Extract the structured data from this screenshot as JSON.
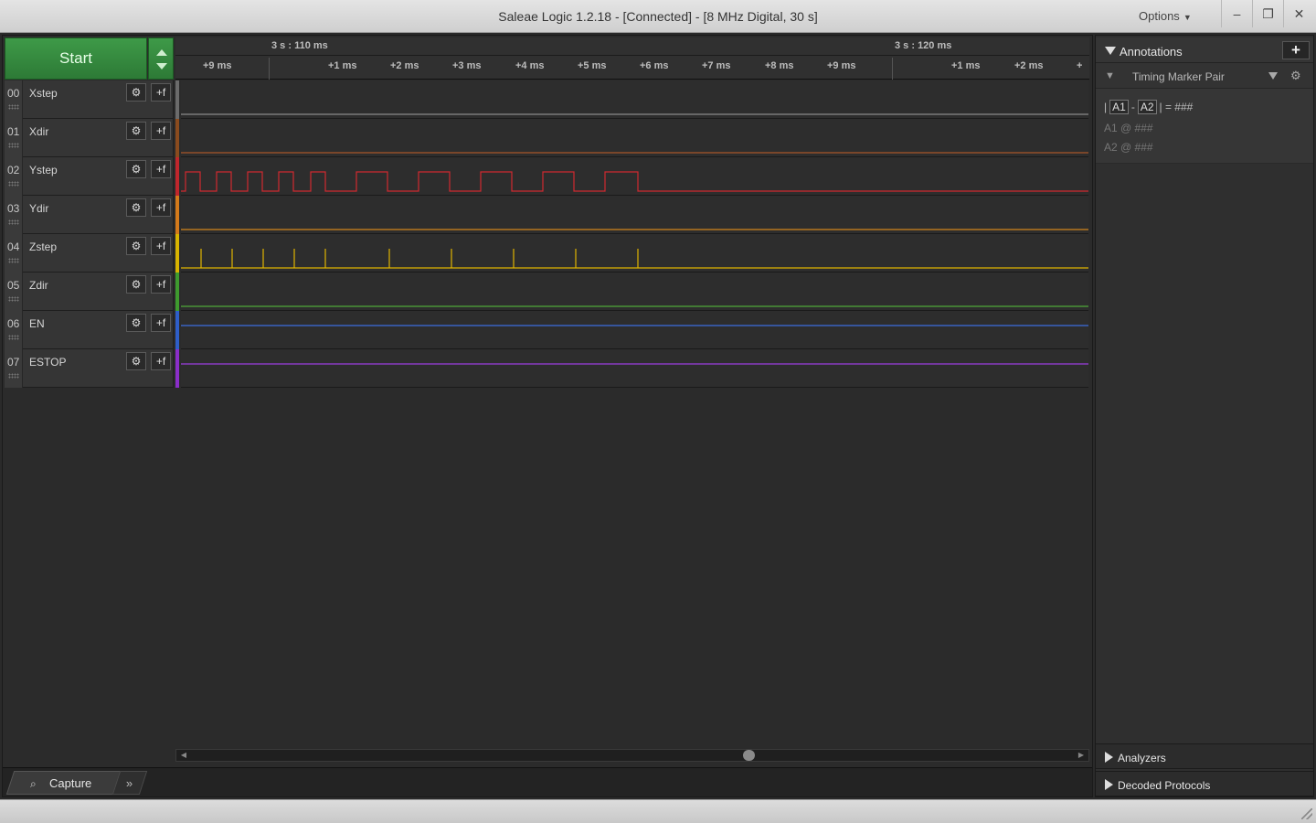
{
  "window": {
    "title": "Saleae Logic 1.2.18 - [Connected] - [8 MHz Digital, 30 s]",
    "options_label": "Options",
    "minimize": "–",
    "restore": "❐",
    "close": "✕"
  },
  "capture": {
    "start_label": "Start"
  },
  "timeline": {
    "major": [
      "3 s : 110 ms",
      "3 s : 120 ms"
    ],
    "minor": [
      "+9 ms",
      "+1 ms",
      "+2 ms",
      "+3 ms",
      "+4 ms",
      "+5 ms",
      "+6 ms",
      "+7 ms",
      "+8 ms",
      "+9 ms",
      "+1 ms",
      "+2 ms",
      "+"
    ]
  },
  "channels": [
    {
      "num": "00",
      "name": "Xstep",
      "color": "#6b6b6b",
      "trace": "#8a8a8a"
    },
    {
      "num": "01",
      "name": "Xdir",
      "color": "#8a4b1e",
      "trace": "#a8562a"
    },
    {
      "num": "02",
      "name": "Ystep",
      "color": "#c0262c",
      "trace": "#d02a30"
    },
    {
      "num": "03",
      "name": "Ydir",
      "color": "#d47a1a",
      "trace": "#d2861c"
    },
    {
      "num": "04",
      "name": "Zstep",
      "color": "#d8b400",
      "trace": "#e0b400"
    },
    {
      "num": "05",
      "name": "Zdir",
      "color": "#3e9a2e",
      "trace": "#4fa83a"
    },
    {
      "num": "06",
      "name": "EN",
      "color": "#2e5ec8",
      "trace": "#3d6ee0"
    },
    {
      "num": "07",
      "name": "ESTOP",
      "color": "#8a2ec8",
      "trace": "#9b3ee0"
    }
  ],
  "channel_buttons": {
    "settings": "⚙",
    "trigger": "+f"
  },
  "bottom": {
    "capture_tab": "Capture",
    "more_tab": "»"
  },
  "right_panel": {
    "annotations_label": "Annotations",
    "add_label": "+",
    "marker_pair": "Timing Marker Pair",
    "measure": {
      "a1": "A1",
      "a2": "A2",
      "equals": "= ###",
      "a1_line": "A1  @  ###",
      "a2_line": "A2  @  ###"
    },
    "analyzers_label": "Analyzers",
    "decoded_label": "Decoded Protocols"
  }
}
